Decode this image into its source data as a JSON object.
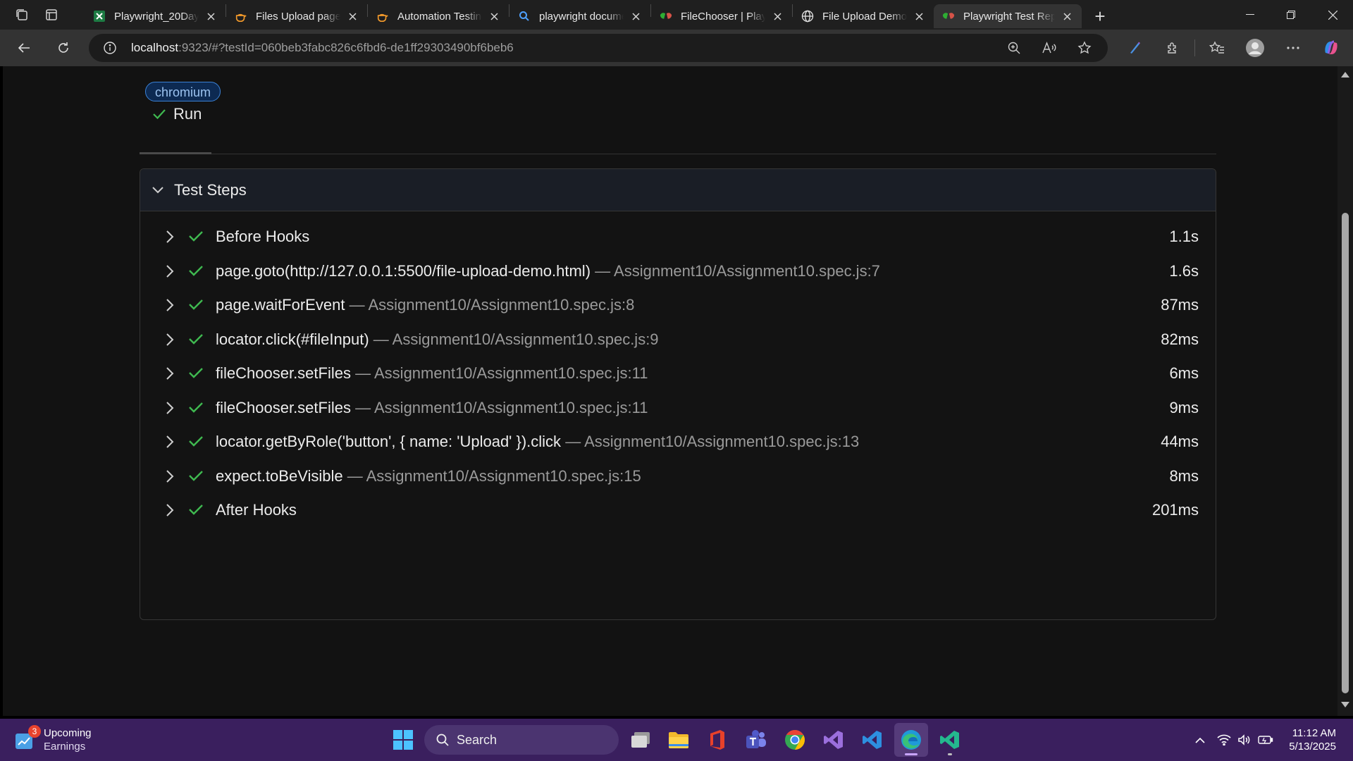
{
  "browser": {
    "tabs": [
      {
        "title": "Playwright_20Day_Ac",
        "favicon": "excel-icon",
        "active": false
      },
      {
        "title": "Files Upload page for",
        "favicon": "teapot-icon",
        "active": false
      },
      {
        "title": "Automation Testing P",
        "favicon": "teapot-icon",
        "active": false
      },
      {
        "title": "playwright document",
        "favicon": "search-icon",
        "active": false
      },
      {
        "title": "FileChooser | Playwrig",
        "favicon": "playwright-icon",
        "active": false
      },
      {
        "title": "File Upload Demo",
        "favicon": "globe-icon",
        "active": false
      },
      {
        "title": "Playwright Test Repor",
        "favicon": "playwright-icon",
        "active": true
      }
    ],
    "address": {
      "host": "localhost",
      "path": ":9323/#?testId=060beb3fabc826c6fbd6-de1ff29303490bf6beb6"
    }
  },
  "report": {
    "project_badge": "chromium",
    "run_tab": "Run",
    "steps_header": "Test Steps",
    "steps": [
      {
        "name": "Before Hooks",
        "location": "",
        "duration": "1.1s"
      },
      {
        "name": "page.goto(http://127.0.0.1:5500/file-upload-demo.html)",
        "location": "— Assignment10/Assignment10.spec.js:7",
        "duration": "1.6s"
      },
      {
        "name": "page.waitForEvent",
        "location": "— Assignment10/Assignment10.spec.js:8",
        "duration": "87ms"
      },
      {
        "name": "locator.click(#fileInput)",
        "location": "— Assignment10/Assignment10.spec.js:9",
        "duration": "82ms"
      },
      {
        "name": "fileChooser.setFiles",
        "location": "— Assignment10/Assignment10.spec.js:11",
        "duration": "6ms"
      },
      {
        "name": "fileChooser.setFiles",
        "location": "— Assignment10/Assignment10.spec.js:11",
        "duration": "9ms"
      },
      {
        "name": "locator.getByRole('button', { name: 'Upload' }).click",
        "location": "— Assignment10/Assignment10.spec.js:13",
        "duration": "44ms"
      },
      {
        "name": "expect.toBeVisible",
        "location": "— Assignment10/Assignment10.spec.js:15",
        "duration": "8ms"
      },
      {
        "name": "After Hooks",
        "location": "",
        "duration": "201ms"
      }
    ]
  },
  "taskbar": {
    "widget_badge": "3",
    "widget_title": "Upcoming",
    "widget_subtitle": "Earnings",
    "search_label": "Search",
    "time": "11:12 AM",
    "date": "5/13/2025"
  },
  "colors": {
    "check_green": "#3fb950",
    "taskbar_bg": "#3a1f5e",
    "badge_border": "#3b82d6"
  }
}
